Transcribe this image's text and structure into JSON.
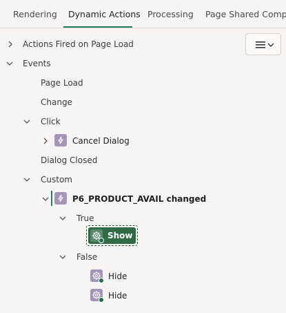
{
  "tabs": [
    {
      "label": "Rendering",
      "active": false
    },
    {
      "label": "Dynamic Actions",
      "active": true
    },
    {
      "label": "Processing",
      "active": false
    },
    {
      "label": "Page Shared Compon",
      "active": false
    }
  ],
  "tree": {
    "actions_fired": "Actions Fired on Page Load",
    "events": "Events",
    "page_load": "Page Load",
    "change": "Change",
    "click": "Click",
    "cancel_dialog": "Cancel Dialog",
    "dialog_closed": "Dialog Closed",
    "custom": "Custom",
    "product_avail": "P6_PRODUCT_AVAIL changed",
    "true_label": "True",
    "show": "Show",
    "false_label": "False",
    "hide_1": "Hide",
    "hide_2": "Hide"
  },
  "icons": {
    "menu": "hamburger-icon",
    "chevron": "chevron-down-icon",
    "dynamic_action": "lightning-icon",
    "action": "gear-icon"
  },
  "colors": {
    "accent": "#1a7f5a",
    "selected_bg": "#2f6b45",
    "tile": "#a394b8"
  }
}
